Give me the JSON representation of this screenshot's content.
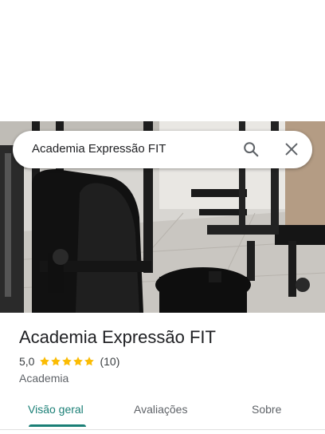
{
  "search": {
    "query": "Academia Expressão FIT",
    "search_icon": "search-icon",
    "close_icon": "close-icon"
  },
  "photo": {
    "subject": "gym-machines-photo"
  },
  "place": {
    "name": "Academia Expressão FIT",
    "rating": "5,0",
    "rating_value": 5.0,
    "star_count": 5,
    "reviews": "(10)",
    "category": "Academia"
  },
  "tabs": [
    {
      "label": "Visão geral",
      "active": true
    },
    {
      "label": "Avaliações",
      "active": false
    },
    {
      "label": "Sobre",
      "active": false
    }
  ],
  "colors": {
    "accent": "#1a7f76",
    "star": "#fbbc04",
    "text": "#202124",
    "muted": "#5f6368"
  }
}
